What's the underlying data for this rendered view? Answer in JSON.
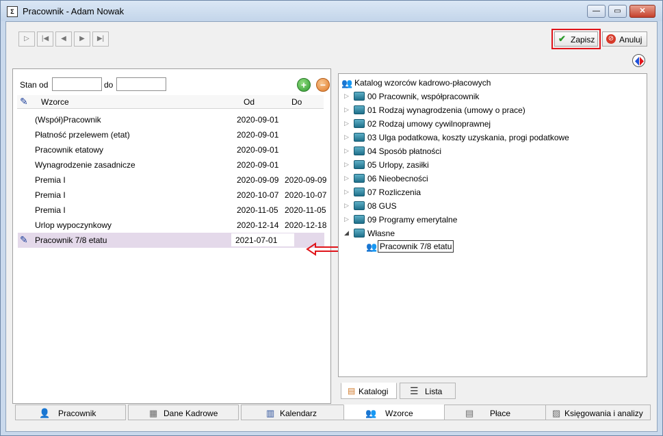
{
  "window": {
    "title": "Pracownik - Adam Nowak",
    "app_icon": "app-icon"
  },
  "toolbar": {
    "nav_icons": [
      "first-record-icon",
      "prev-record-icon",
      "next-record-icon",
      "last-record-icon"
    ],
    "save_label": "Zapisz",
    "cancel_label": "Anuluj",
    "save_icon": "check-icon",
    "cancel_icon": "cancel-icon"
  },
  "filter": {
    "from_label": "Stan od",
    "to_label": "do",
    "from_value": "",
    "to_value": ""
  },
  "grid": {
    "columns": [
      "Wzorce",
      "Od",
      "Do"
    ],
    "rows": [
      {
        "name": "(Współ)Pracownik",
        "from": "2020-09-01",
        "to": ""
      },
      {
        "name": "Płatność przelewem (etat)",
        "from": "2020-09-01",
        "to": ""
      },
      {
        "name": "Pracownik etatowy",
        "from": "2020-09-01",
        "to": ""
      },
      {
        "name": "Wynagrodzenie zasadnicze",
        "from": "2020-09-01",
        "to": ""
      },
      {
        "name": "Premia I",
        "from": "2020-09-09",
        "to": "2020-09-09"
      },
      {
        "name": "Premia I",
        "from": "2020-10-07",
        "to": "2020-10-07"
      },
      {
        "name": "Premia I",
        "from": "2020-11-05",
        "to": "2020-11-05"
      },
      {
        "name": "Urlop wypoczynkowy",
        "from": "2020-12-14",
        "to": "2020-12-18"
      },
      {
        "name": "Pracownik 7/8 etatu",
        "from": "2021-07-01",
        "to": ""
      }
    ]
  },
  "catalog": {
    "root": "Katalog wzorców kadrowo-płacowych",
    "items": [
      "00 Pracownik, współpracownik",
      "01 Rodzaj wynagrodzenia (umowy o prace)",
      "02 Rodzaj umowy cywilnoprawnej",
      "03 Ulga podatkowa, koszty uzyskania, progi podatkowe",
      "04 Sposób płatności",
      "05 Urlopy, zasiłki",
      "06 Nieobecności",
      "07 Rozliczenia",
      "08 GUS",
      "09 Programy emerytalne",
      "Własne"
    ],
    "own_child": "Pracownik 7/8 etatu"
  },
  "subtabs": [
    "Katalogi",
    "Lista"
  ],
  "bottom_tabs": [
    "Pracownik",
    "Dane Kadrowe",
    "Kalendarz",
    "Wzorce",
    "Płace",
    "Księgowania i analizy"
  ],
  "colors": {
    "accent_red": "#e0141a",
    "selection": "#e4d9ea",
    "green": "#3aa53a",
    "orange": "#e8873a"
  }
}
